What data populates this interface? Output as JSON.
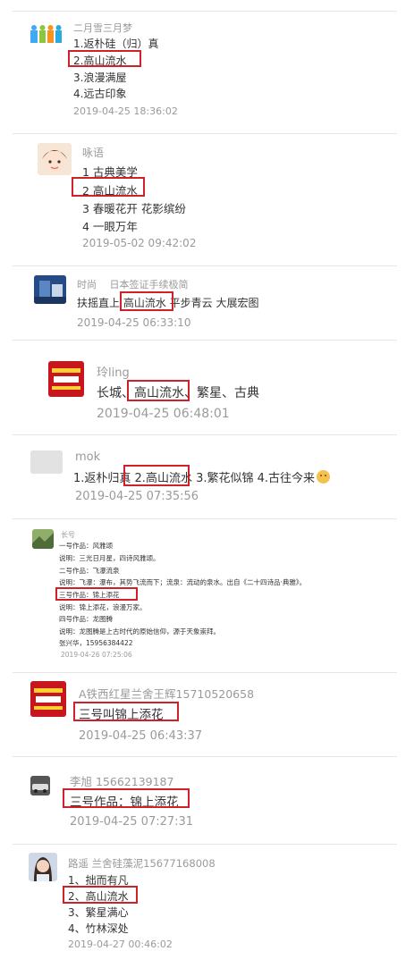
{
  "comments": [
    {
      "name": "二月雪三月梦",
      "lines": [
        "1.返朴硅（归）真",
        "2.高山流水",
        "3.浪漫满屋",
        "4.远古印象"
      ],
      "time": "2019-04-25 18:36:02"
    },
    {
      "name": "咏语",
      "lines": [
        "1 古典美学",
        "2 高山流水",
        "3 春暖花开 花影缤纷",
        "4 一眼万年"
      ],
      "time": "2019-05-02 09:42:02"
    },
    {
      "name": "时尚　 日本签证手续极简",
      "lines": [
        "扶摇直上 高山流水 平步青云 大展宏图"
      ],
      "time": "2019-04-25 06:33:10"
    },
    {
      "name": "玲ling",
      "lines": [
        "长城、高山流水、繁星、古典"
      ],
      "time": "2019-04-25 06:48:01"
    },
    {
      "name": "mok",
      "lines": [
        "1.返朴归真 2.高山流水 3.繁花似锦 4.古往今来"
      ],
      "time": "2019-04-25 07:35:56"
    },
    {
      "name": "长号",
      "lines": [
        "一号作品：风雅颂",
        "说明：三光日月星，四诗风雅颂。",
        "二号作品：飞瀑流泉",
        "说明：飞瀑：瀑布，其势飞流而下；流泉：流动的泉水。出自《二十四诗品·典雅》。",
        "三号作品：锦上添花",
        "说明：锦上添花，浪漫万家。",
        "四号作品：龙图腾",
        "说明：龙图腾是上古时代的原始信仰，源于天象崇拜。",
        "张兴华，15956384422"
      ],
      "time": "2019-04-26 07:25:06"
    },
    {
      "name": "A铁西红星兰舍王辉15710520658",
      "lines": [
        "三号叫锦上添花"
      ],
      "time": "2019-04-25 06:43:37"
    },
    {
      "name": "李旭 15662139187",
      "lines": [
        "三号作品：锦上添花"
      ],
      "time": "2019-04-25 07:27:31"
    },
    {
      "name": "路遥 兰舍硅藻泥15677168008",
      "lines": [
        "1、拙而有凡",
        "2、高山流水",
        "3、繁星满心",
        "4、竹林深处"
      ],
      "time": "2019-04-27 00:46:02"
    }
  ],
  "avatars": {
    "c1": "colorful-people-logo",
    "c2": "cartoon-girl",
    "c3": "blue-photo",
    "c4": "red-poster",
    "c5": "blank-gray",
    "c6": "green-landscape",
    "c7": "red-poster",
    "c8": "car-photo",
    "c9": "woman-photo"
  },
  "colors": {
    "highlight": "#d0202a",
    "meta": "#9a9a9a",
    "text": "#333333"
  }
}
